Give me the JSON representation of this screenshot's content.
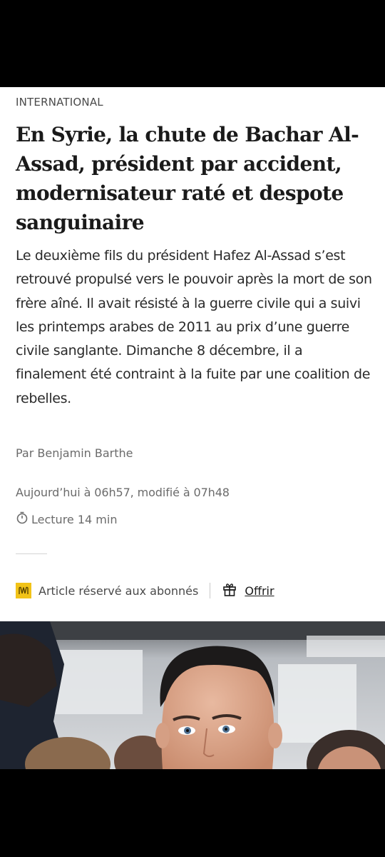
{
  "article": {
    "rubric": "INTERNATIONAL",
    "headline": "En Syrie, la chute de Bachar Al-Assad, président par accident, modernisateur raté et despote sanguinaire",
    "lede": "Le deuxième fils du président Hafez Al-Assad s’est retrouvé propulsé vers le pouvoir après la mort de son frère aîné. Il avait résisté à la guerre civile qui a suivi les printemps arabes de 2011 au prix d’une guerre civile sanglante. Dimanche 8 décembre, il a finalement été contraint à la fuite par une coalition de rebelles.",
    "byline": "Par Benjamin Barthe",
    "dates": "Aujourd’hui à 06h57, modifié à 07h48",
    "reading_time": "Lecture 14 min"
  },
  "premium": {
    "label": "Article réservé aux abonnés",
    "offer_label": "Offrir",
    "badge_color": "#f2c318"
  },
  "icons": {
    "brand": "le-monde-m-icon",
    "timer": "stopwatch-icon",
    "gift": "gift-icon"
  }
}
